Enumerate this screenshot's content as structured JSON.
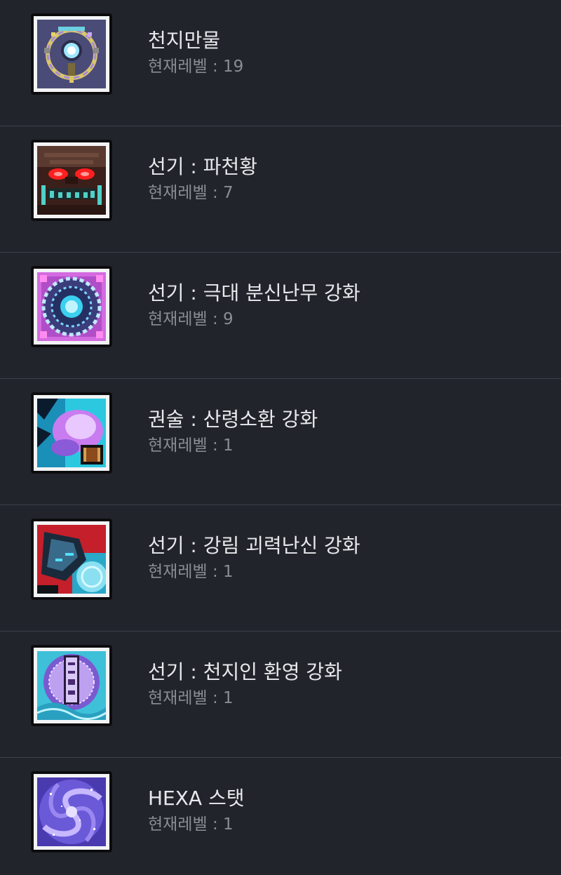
{
  "skills": [
    {
      "name": "천지만물",
      "level_label": "현재레벨 : 19",
      "icon": "celestial-crest-icon"
    },
    {
      "name": "선기 : 파천황",
      "level_label": "현재레벨 : 7",
      "icon": "demon-face-icon"
    },
    {
      "name": "선기 : 극대 분신난무 강화",
      "level_label": "현재레벨 : 9",
      "icon": "blue-orb-mandala-icon"
    },
    {
      "name": "권술 : 산령소환 강화",
      "level_label": "현재레벨 : 1",
      "icon": "spirit-summon-scroll-icon"
    },
    {
      "name": "선기 : 강림 괴력난신 강화",
      "level_label": "현재레벨 : 1",
      "icon": "dragon-descent-icon"
    },
    {
      "name": "선기 : 천지인 환영 강화",
      "level_label": "현재레벨 : 1",
      "icon": "talisman-vortex-icon"
    },
    {
      "name": "HEXA 스탯",
      "level_label": "현재레벨 : 1",
      "icon": "galaxy-swirl-icon"
    }
  ],
  "colors": {
    "background": "#21242b",
    "title_text": "#e8e9ec",
    "level_text": "#8a8d94",
    "divider": "#3c4048"
  }
}
